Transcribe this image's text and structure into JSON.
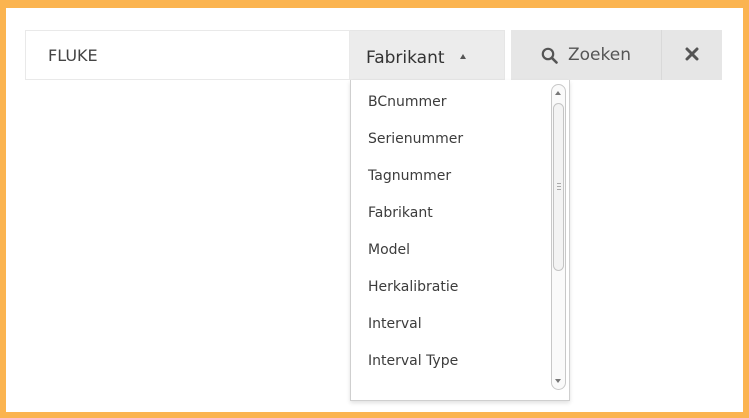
{
  "search": {
    "value": "FLUKE",
    "placeholder": ""
  },
  "filter": {
    "selected": "Fabrikant",
    "options": [
      "BCnummer",
      "Serienummer",
      "Tagnummer",
      "Fabrikant",
      "Model",
      "Herkalibratie",
      "Interval",
      "Interval Type"
    ]
  },
  "actions": {
    "search_label": "Zoeken",
    "search_icon": "search-icon",
    "clear_icon": "close-icon"
  },
  "colors": {
    "frame_border": "#fbb450",
    "button_bg": "#e6e6e6"
  }
}
